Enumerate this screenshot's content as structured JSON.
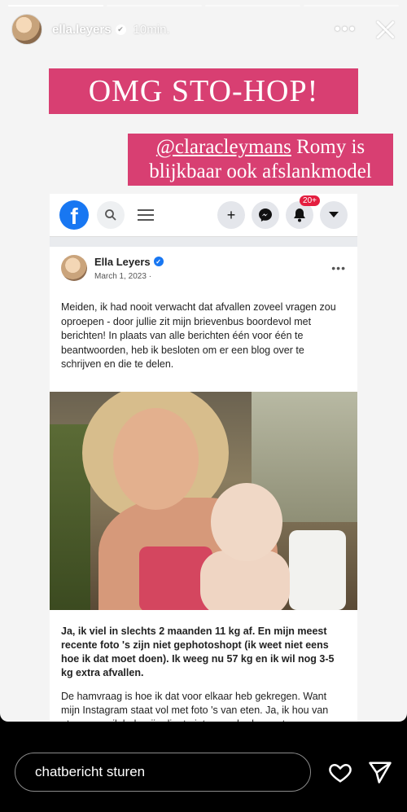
{
  "story": {
    "username": "ella.leyers",
    "verified_mark": "✔",
    "time_ago": "10min.",
    "progress_segments": 4,
    "progress_current": 1
  },
  "stickers": {
    "headline": "OMG STO-HOP!",
    "mention": "@claracleymans",
    "mention_rest_line1": " Romy is",
    "line2": "blijkbaar ook afslankmodel"
  },
  "facebook": {
    "logo_letter": "f",
    "notifications": "20+",
    "post": {
      "author": "Ella Leyers",
      "date": "March 1, 2023 ·",
      "paragraph1": "Meiden, ik had nooit verwacht dat afvallen zoveel vragen zou oproepen - door jullie zit mijn brievenbus boordevol met berichten! In plaats van alle berichten één voor één te beantwoorden, heb ik besloten om er een blog over te schrijven en die te delen.",
      "paragraph2_bold": "Ja, ik viel in slechts 2 maanden 11 kg af. En mijn meest recente foto 's zijn niet gephotoshopt (ik weet niet eens hoe ik dat moet doen). Ik weeg nu 57 kg en ik wil nog 3-5 kg extra afvallen.",
      "paragraph3": "De hamvraag is hoe ik dat voor elkaar heb gekregen. Want mijn Instagram staat vol met foto 's van eten. Ja, ik hou van eten, maar ik heb mijn dieet niet veranderd en eet nog"
    }
  },
  "reply": {
    "placeholder": "chatbericht sturen"
  },
  "colors": {
    "sticker": "#d83f72",
    "facebook_blue": "#1877f2"
  }
}
